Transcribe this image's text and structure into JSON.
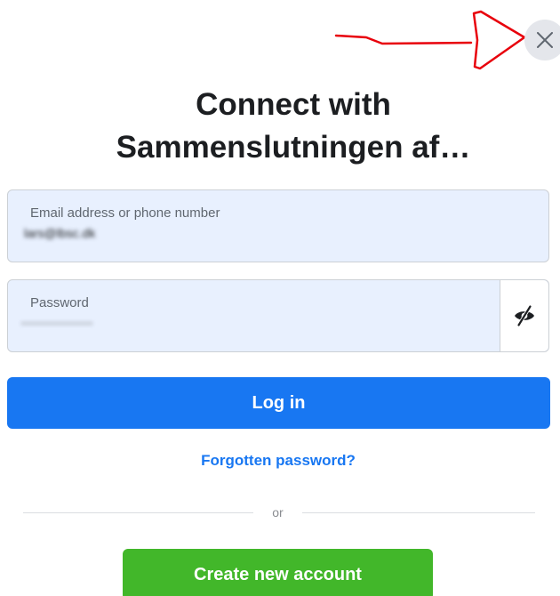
{
  "dialog": {
    "title_line1": "Connect with",
    "title_line2": "Sammenslutningen af…"
  },
  "icons": {
    "close": "close-icon",
    "eye": "eye-slash-icon"
  },
  "form": {
    "email_label": "Email address or phone number",
    "email_value": "lars@lbsc.dk",
    "password_label": "Password",
    "password_value": "••••••••••••••••••"
  },
  "actions": {
    "login_label": "Log in",
    "forgot_label": "Forgotten password?",
    "divider_label": "or",
    "create_label": "Create new account"
  },
  "colors": {
    "primary": "#1877f2",
    "success": "#42b72a",
    "field_background": "#e8f0fe",
    "annotation": "#e8000b"
  }
}
